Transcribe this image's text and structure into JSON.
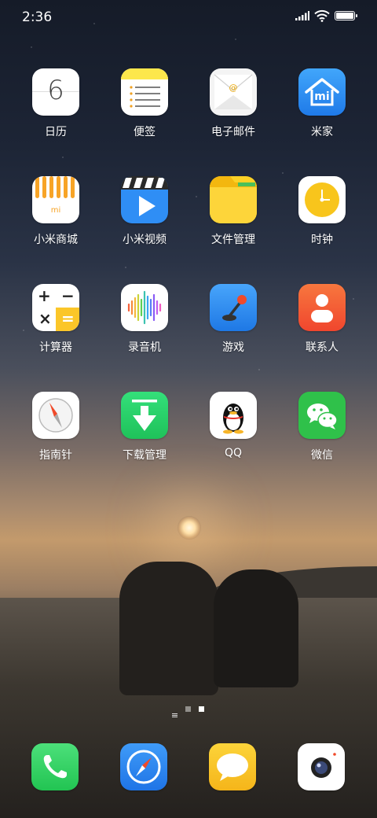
{
  "status_bar": {
    "time": "2:36",
    "battery_level": 1.0
  },
  "apps": [
    {
      "label": "日历",
      "icon": "calendar-icon",
      "date": "6"
    },
    {
      "label": "便签",
      "icon": "notes-icon"
    },
    {
      "label": "电子邮件",
      "icon": "email-icon",
      "at": "@"
    },
    {
      "label": "米家",
      "icon": "mi-home-icon",
      "text": "mi"
    },
    {
      "label": "小米商城",
      "icon": "mi-store-icon",
      "text": "mi"
    },
    {
      "label": "小米视频",
      "icon": "video-icon"
    },
    {
      "label": "文件管理",
      "icon": "folder-icon"
    },
    {
      "label": "时钟",
      "icon": "clock-icon"
    },
    {
      "label": "计算器",
      "icon": "calculator-icon",
      "plus": "+",
      "minus": "−",
      "times": "×",
      "equals": "="
    },
    {
      "label": "录音机",
      "icon": "recorder-icon"
    },
    {
      "label": "游戏",
      "icon": "game-icon"
    },
    {
      "label": "联系人",
      "icon": "contacts-icon"
    },
    {
      "label": "指南针",
      "icon": "compass-icon"
    },
    {
      "label": "下载管理",
      "icon": "download-icon"
    },
    {
      "label": "QQ",
      "icon": "qq-icon"
    },
    {
      "label": "微信",
      "icon": "wechat-icon"
    }
  ],
  "page_indicator": {
    "count": 3,
    "current": 3
  },
  "dock": [
    {
      "icon": "phone-icon"
    },
    {
      "icon": "browser-icon"
    },
    {
      "icon": "messages-icon"
    },
    {
      "icon": "camera-icon"
    }
  ],
  "colors": {
    "label": "#ffffff",
    "notes_yellow": "#fde74c",
    "mi_home_blue": "#2a8ef0",
    "store_orange": "#f7a427",
    "video_blue": "#2f8ef5",
    "folder_yellow": "#fcd126",
    "clock_yellow": "#f8c51c",
    "calc_yellow": "#fbc629",
    "game_blue": "#2e8ff3",
    "contacts_orange": "#f5613a",
    "download_green": "#29d36a",
    "wechat_green": "#2fc14a",
    "phone_green": "#3cd464",
    "browser_blue": "#2e86f0",
    "messages_yellow": "#f8c52a"
  }
}
